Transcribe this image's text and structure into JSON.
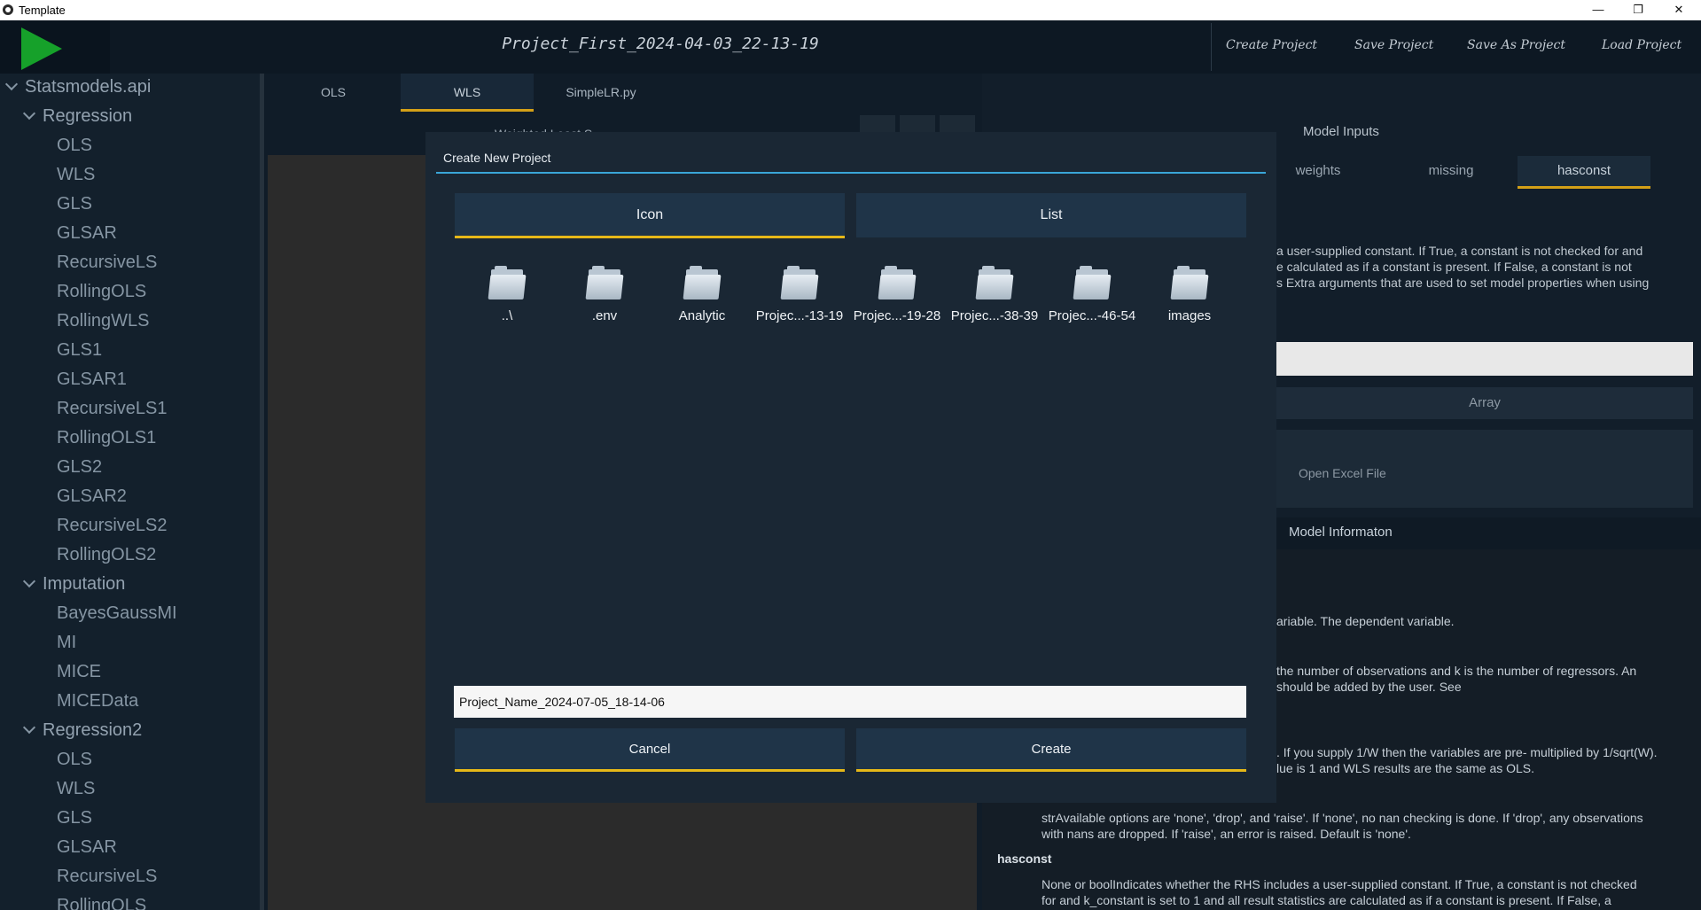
{
  "window": {
    "title": "Template",
    "minimize": "—",
    "maximize": "❐",
    "close": "✕"
  },
  "header": {
    "project_title": "Project_First_2024-04-03_22-13-19",
    "buttons": [
      "Create Project",
      "Save Project",
      "Save As Project",
      "Load Project"
    ]
  },
  "sidebar": {
    "root": "Statsmodels.api",
    "groups": [
      {
        "label": "Regression",
        "items": [
          "OLS",
          "WLS",
          "GLS",
          "GLSAR",
          "RecursiveLS",
          "RollingOLS",
          "RollingWLS",
          "GLS1",
          "GLSAR1",
          "RecursiveLS1",
          "RollingOLS1",
          "GLS2",
          "GLSAR2",
          "RecursiveLS2",
          "RollingOLS2"
        ]
      },
      {
        "label": "Imputation",
        "items": [
          "BayesGaussMI",
          "MI",
          "MICE",
          "MICEData"
        ]
      },
      {
        "label": "Regression2",
        "items": [
          "OLS",
          "WLS",
          "GLS",
          "GLSAR",
          "RecursiveLS",
          "RollingOLS"
        ]
      }
    ]
  },
  "workspace": {
    "tabs": [
      "OLS",
      "WLS",
      "SimpleLR.py"
    ],
    "active_tab": "WLS",
    "partial_label": "Weighted Least S..."
  },
  "right_pane": {
    "model_inputs_label": "Model Inputs",
    "tabs": [
      "weights",
      "missing",
      "hasconst"
    ],
    "active_tab": "hasconst",
    "description_lines": [
      "a user-supplied constant. If True, a constant is not checked for and",
      "e calculated as if a constant is present. If False, a constant is not",
      "s Extra arguments that are used to set model properties when using"
    ],
    "array_label": "Array",
    "open_excel_label": "Open Excel File",
    "model_info_label": "Model Informaton",
    "doc_lines": [
      "ariable. The dependent variable.",
      " the number of observations and k is the number of regressors. An",
      "should be added by the user. See",
      ". If you supply 1/W then the variables are pre- multiplied by 1/sqrt(W).",
      "lue is 1 and WLS results are the same as OLS.",
      "strAvailable options are 'none', 'drop', and 'raise'. If 'none', no nan checking is done. If 'drop', any observations",
      "with nans are dropped. If 'raise', an error is raised. Default is 'none'.",
      "None or boolIndicates whether the RHS includes a user-supplied constant. If True, a constant is not checked",
      "for and k_constant is set to 1 and all result statistics are calculated as if a constant is present. If False, a"
    ],
    "doc_heading": "hasconst"
  },
  "dialog": {
    "title": "Create New Project",
    "view_icon": "Icon",
    "view_list": "List",
    "files": [
      "..\\",
      ".env",
      "Analytic",
      "Projec...-13-19",
      "Projec...-19-28",
      "Projec...-38-39",
      "Projec...-46-54",
      "images"
    ],
    "project_name_value": "Project_Name_2024-07-05_18-14-06",
    "cancel_label": "Cancel",
    "create_label": "Create"
  },
  "colors": {
    "accent": "#e6b818",
    "title_line": "#3aa6d8",
    "run": "#16a12a"
  }
}
